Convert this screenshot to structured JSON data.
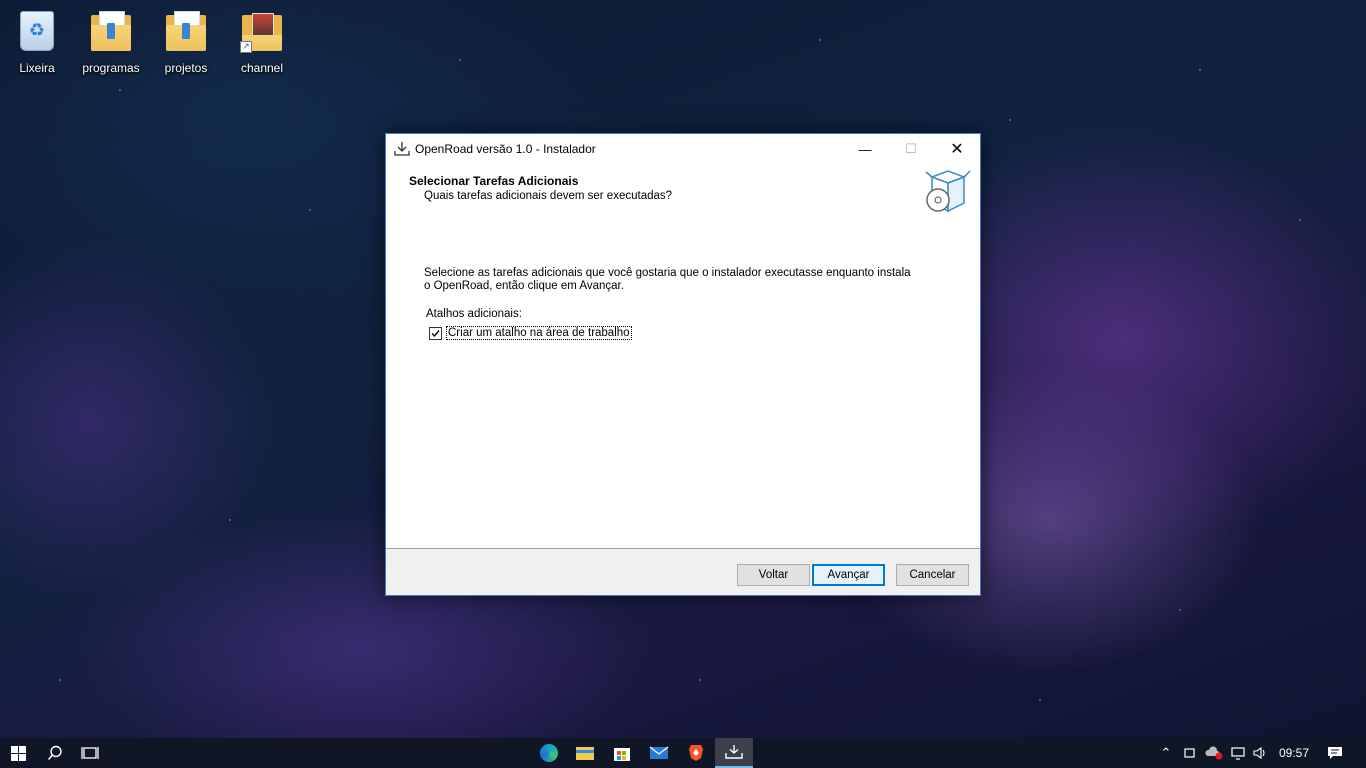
{
  "desktop": {
    "icons": [
      {
        "label": "Lixeira",
        "icon": "recycle-bin-icon"
      },
      {
        "label": "programas",
        "icon": "folder-icon"
      },
      {
        "label": "projetos",
        "icon": "folder-icon"
      },
      {
        "label": "channel",
        "icon": "shortcut-icon"
      }
    ]
  },
  "installer": {
    "title": "OpenRoad versão 1.0 - Instalador",
    "heading": "Selecionar Tarefas Adicionais",
    "subheading": "Quais tarefas adicionais devem ser executadas?",
    "intro": "Selecione as tarefas adicionais que você gostaria que o instalador executasse enquanto instala o OpenRoad, então clique em Avançar.",
    "group_label": "Atalhos adicionais:",
    "checkbox": {
      "label": "Criar um atalho na área de trabalho",
      "checked": true
    },
    "buttons": {
      "back": "Voltar",
      "next": "Avançar",
      "cancel": "Cancelar"
    },
    "window_buttons": {
      "minimize": "—",
      "maximize": "☐",
      "close": "✕"
    }
  },
  "taskbar": {
    "apps": [
      "edge-icon",
      "file-explorer-icon",
      "store-icon",
      "mail-icon",
      "brave-icon",
      "installer-icon"
    ],
    "clock": "09:57",
    "accent_color": "#0078d7"
  }
}
